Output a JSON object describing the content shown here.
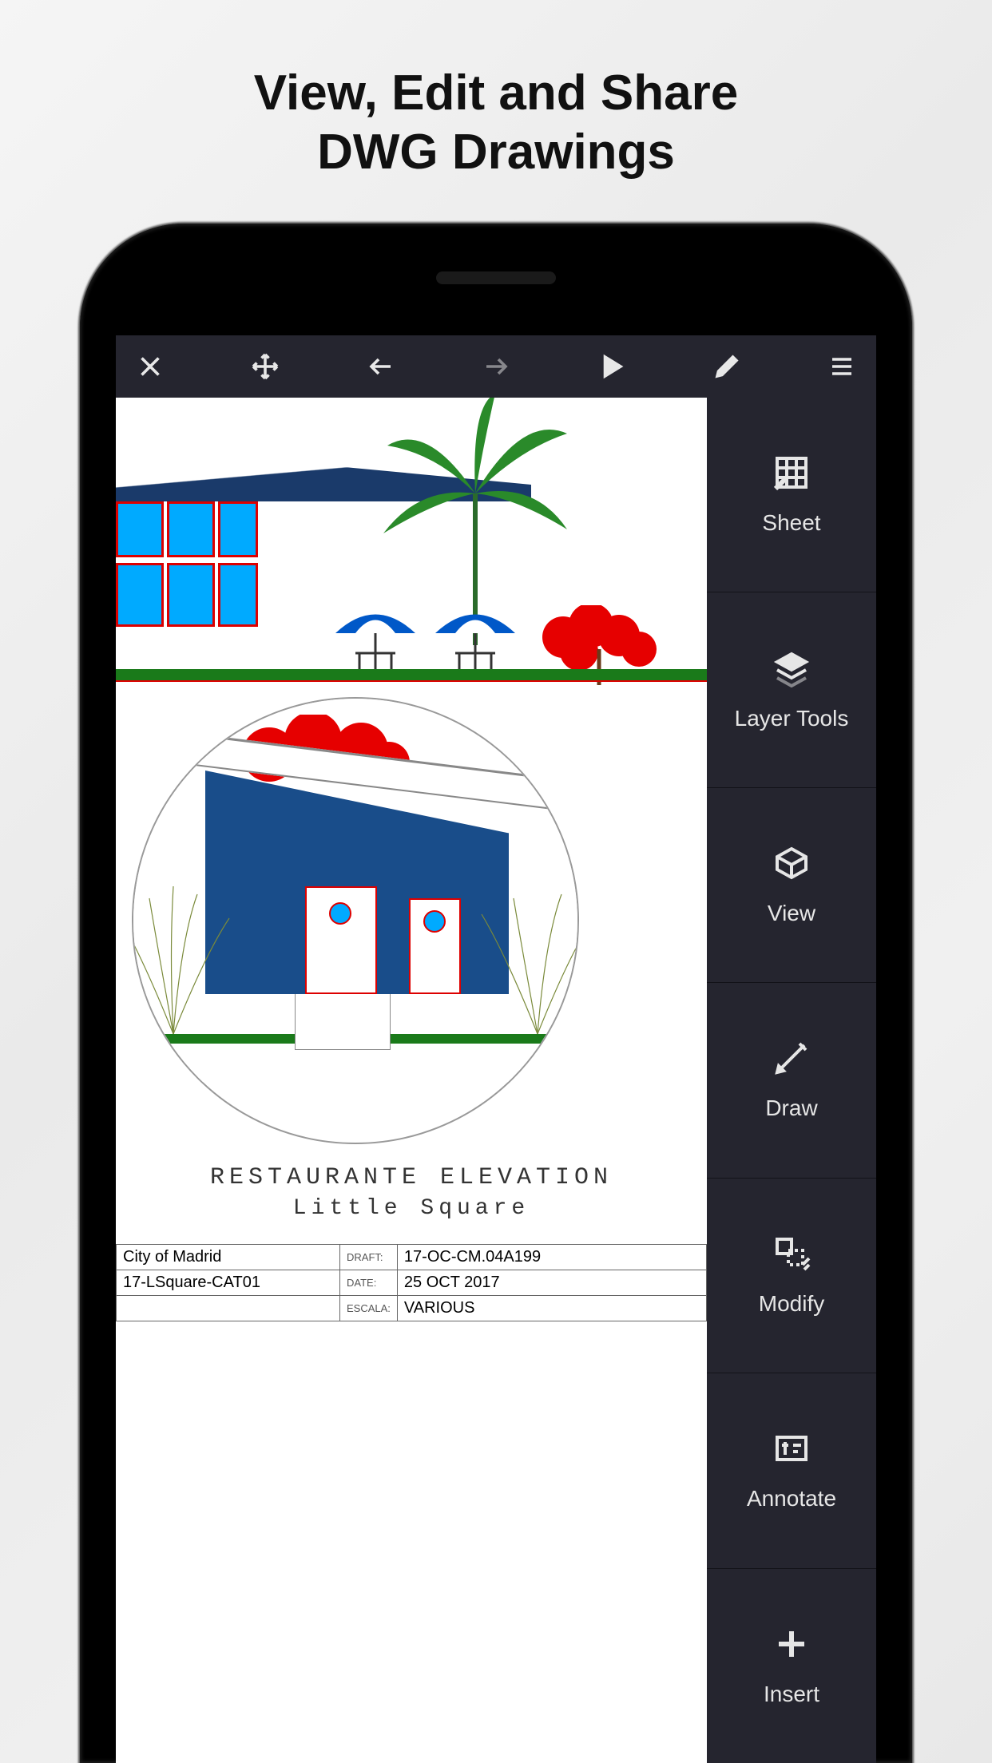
{
  "headline": {
    "line1": "View, Edit and Share",
    "line2": "DWG Drawings"
  },
  "toolbar": {
    "close": "close",
    "move": "move",
    "undo": "undo",
    "redo": "redo",
    "play": "play",
    "edit": "edit",
    "menu": "menu"
  },
  "sidebar": {
    "items": [
      {
        "label": "Sheet",
        "icon": "grid-sheet-icon"
      },
      {
        "label": "Layer Tools",
        "icon": "layers-icon"
      },
      {
        "label": "View",
        "icon": "cube-icon"
      },
      {
        "label": "Draw",
        "icon": "pencil-line-icon"
      },
      {
        "label": "Modify",
        "icon": "modify-icon"
      },
      {
        "label": "Annotate",
        "icon": "annotate-icon"
      },
      {
        "label": "Insert",
        "icon": "plus-icon"
      }
    ]
  },
  "drawing": {
    "title1": "RESTAURANTE ELEVATION",
    "title2": "Little Square",
    "info": {
      "client": "City of Madrid",
      "draft_label": "DRAFT:",
      "draft_value": "17-OC-CM.04A199",
      "file": "17-LSquare-CAT01",
      "date_label": "DATE:",
      "date_value": "25 OCT 2017",
      "escala_label": "ESCALA:",
      "escala_value": "VARIOUS"
    }
  }
}
